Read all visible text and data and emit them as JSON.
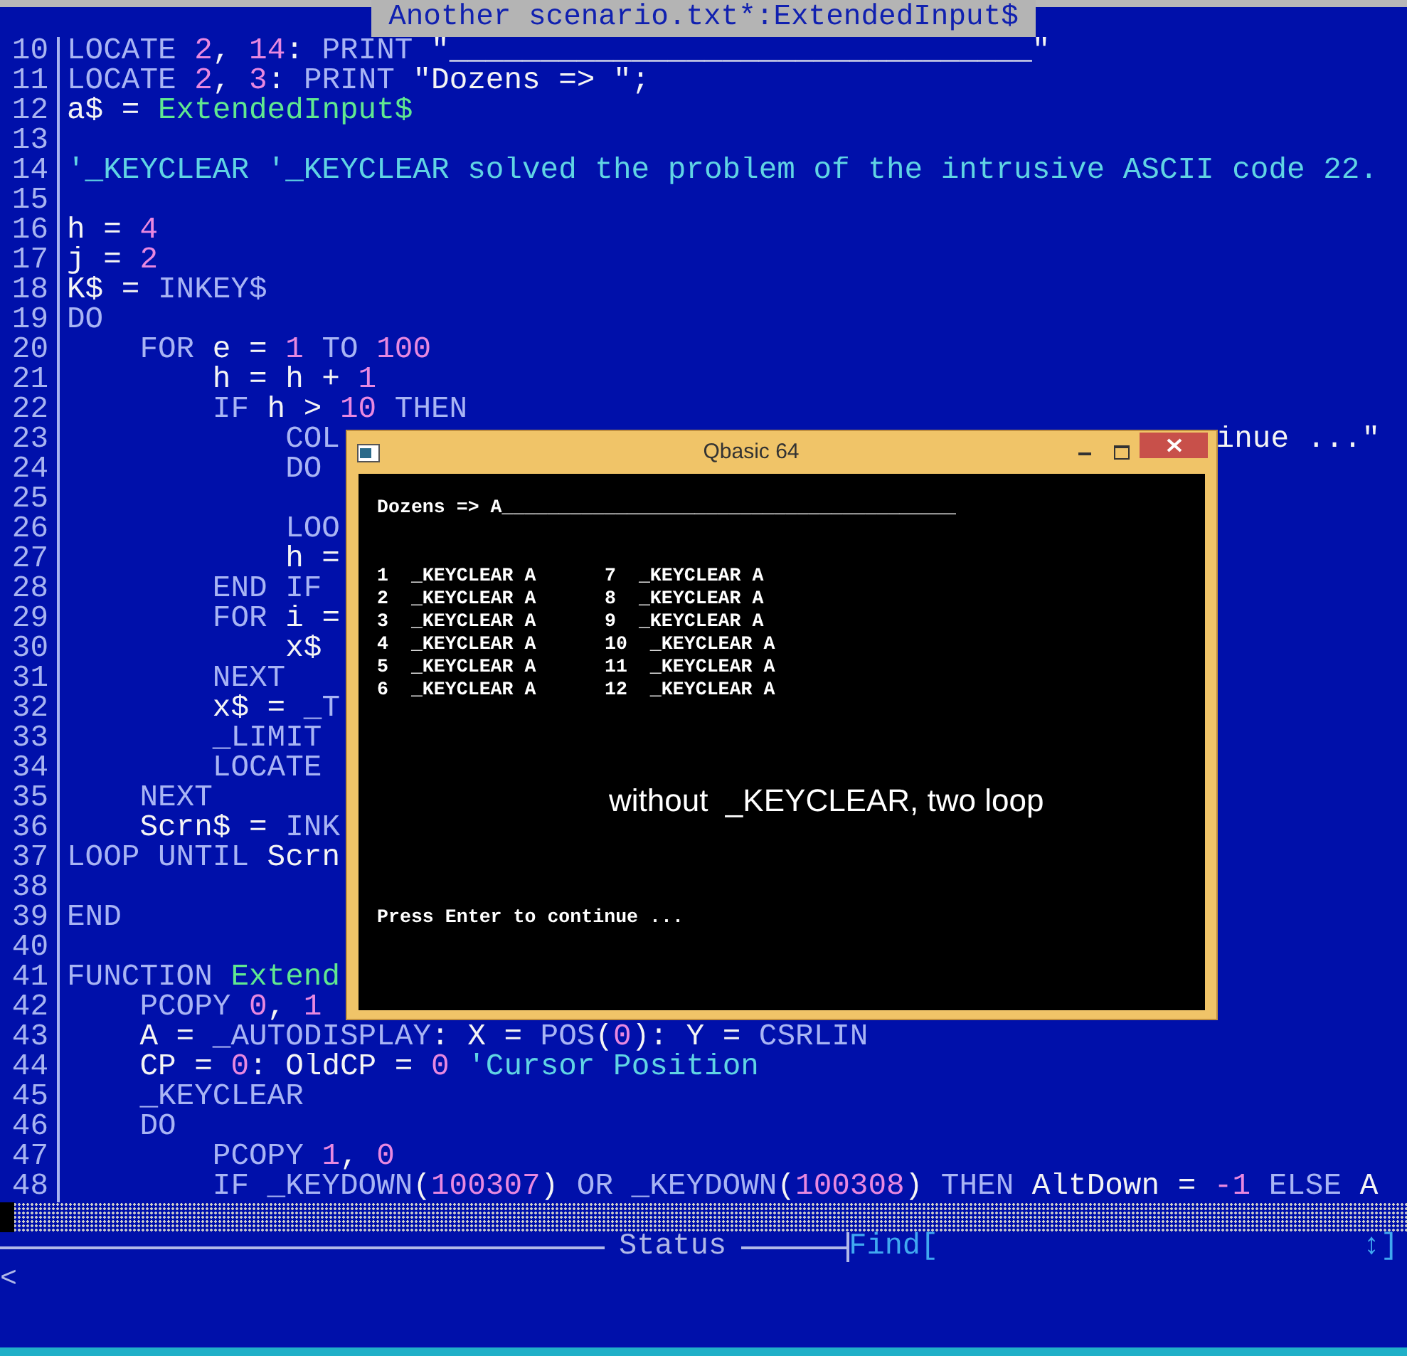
{
  "editor": {
    "title": "Another scenario.txt*:ExtendedInput$",
    "lines": [
      {
        "number": "10",
        "tokens": [
          {
            "kind": "kw",
            "text": "LOCATE "
          },
          {
            "kind": "num",
            "text": "2"
          },
          {
            "kind": "id",
            "text": ", "
          },
          {
            "kind": "num",
            "text": "14"
          },
          {
            "kind": "id",
            "text": ": "
          },
          {
            "kind": "kw",
            "text": "PRINT "
          },
          {
            "kind": "str",
            "text": "\"________________________________\""
          }
        ]
      },
      {
        "number": "11",
        "tokens": [
          {
            "kind": "kw",
            "text": "LOCATE "
          },
          {
            "kind": "num",
            "text": "2"
          },
          {
            "kind": "id",
            "text": ", "
          },
          {
            "kind": "num",
            "text": "3"
          },
          {
            "kind": "id",
            "text": ": "
          },
          {
            "kind": "kw",
            "text": "PRINT "
          },
          {
            "kind": "str",
            "text": "\"Dozens => \";"
          }
        ]
      },
      {
        "number": "12",
        "tokens": [
          {
            "kind": "id",
            "text": "a$ = "
          },
          {
            "kind": "fn",
            "text": "ExtendedInput$"
          }
        ]
      },
      {
        "number": "13"
      },
      {
        "number": "14",
        "tokens": [
          {
            "kind": "cmt",
            "text": "'_KEYCLEAR '_KEYCLEAR solved the problem of the intrusive ASCII code 22."
          }
        ]
      },
      {
        "number": "15"
      },
      {
        "number": "16",
        "tokens": [
          {
            "kind": "id",
            "text": "h = "
          },
          {
            "kind": "num",
            "text": "4"
          }
        ]
      },
      {
        "number": "17",
        "tokens": [
          {
            "kind": "id",
            "text": "j = "
          },
          {
            "kind": "num",
            "text": "2"
          }
        ]
      },
      {
        "number": "18",
        "tokens": [
          {
            "kind": "id",
            "text": "K$ = "
          },
          {
            "kind": "kw",
            "text": "INKEY$"
          }
        ]
      },
      {
        "number": "19",
        "tokens": [
          {
            "kind": "kw",
            "text": "DO"
          }
        ]
      },
      {
        "number": "20",
        "tokens": [
          {
            "kind": "kw",
            "text": "    FOR "
          },
          {
            "kind": "id",
            "text": "e = "
          },
          {
            "kind": "num",
            "text": "1"
          },
          {
            "kind": "kw",
            "text": " TO "
          },
          {
            "kind": "num",
            "text": "100"
          }
        ]
      },
      {
        "number": "21",
        "tokens": [
          {
            "kind": "id",
            "text": "        h = h + "
          },
          {
            "kind": "num",
            "text": "1"
          }
        ]
      },
      {
        "number": "22",
        "tokens": [
          {
            "kind": "kw",
            "text": "        IF "
          },
          {
            "kind": "id",
            "text": "h > "
          },
          {
            "kind": "num",
            "text": "10"
          },
          {
            "kind": "kw",
            "text": " THEN"
          }
        ]
      },
      {
        "number": "23",
        "tokens": [
          {
            "kind": "kw",
            "text": "            COL"
          }
        ],
        "tail": [
          {
            "kind": "str",
            "text": "inue ...\""
          }
        ]
      },
      {
        "number": "24",
        "tokens": [
          {
            "kind": "kw",
            "text": "            DO"
          }
        ]
      },
      {
        "number": "25"
      },
      {
        "number": "26",
        "tokens": [
          {
            "kind": "kw",
            "text": "            LOO"
          }
        ]
      },
      {
        "number": "27",
        "tokens": [
          {
            "kind": "id",
            "text": "            h ="
          }
        ]
      },
      {
        "number": "28",
        "tokens": [
          {
            "kind": "kw",
            "text": "        END IF"
          }
        ]
      },
      {
        "number": "29",
        "tokens": [
          {
            "kind": "kw",
            "text": "        FOR "
          },
          {
            "kind": "id",
            "text": "i ="
          }
        ]
      },
      {
        "number": "30",
        "tokens": [
          {
            "kind": "id",
            "text": "            x$"
          }
        ]
      },
      {
        "number": "31",
        "tokens": [
          {
            "kind": "kw",
            "text": "        NEXT"
          }
        ]
      },
      {
        "number": "32",
        "tokens": [
          {
            "kind": "id",
            "text": "        x$ = "
          },
          {
            "kind": "kw",
            "text": "_T"
          }
        ]
      },
      {
        "number": "33",
        "tokens": [
          {
            "kind": "kw",
            "text": "        _LIMIT"
          }
        ]
      },
      {
        "number": "34",
        "tokens": [
          {
            "kind": "kw",
            "text": "        LOCATE"
          }
        ]
      },
      {
        "number": "35",
        "tokens": [
          {
            "kind": "kw",
            "text": "    NEXT"
          }
        ]
      },
      {
        "number": "36",
        "tokens": [
          {
            "kind": "id",
            "text": "    Scrn$ = "
          },
          {
            "kind": "kw",
            "text": "INK"
          }
        ]
      },
      {
        "number": "37",
        "tokens": [
          {
            "kind": "kw",
            "text": "LOOP UNTIL "
          },
          {
            "kind": "id",
            "text": "Scrn"
          }
        ]
      },
      {
        "number": "38"
      },
      {
        "number": "39",
        "tokens": [
          {
            "kind": "kw",
            "text": "END"
          }
        ]
      },
      {
        "number": "40"
      },
      {
        "number": "41",
        "tokens": [
          {
            "kind": "kw",
            "text": "FUNCTION "
          },
          {
            "kind": "fn",
            "text": "Extend"
          }
        ]
      },
      {
        "number": "42",
        "tokens": [
          {
            "kind": "kw",
            "text": "    PCOPY "
          },
          {
            "kind": "num",
            "text": "0"
          },
          {
            "kind": "id",
            "text": ", "
          },
          {
            "kind": "num",
            "text": "1"
          }
        ]
      },
      {
        "number": "43",
        "tokens": [
          {
            "kind": "id",
            "text": "    A = "
          },
          {
            "kind": "kw",
            "text": "_AUTODISPLAY"
          },
          {
            "kind": "id",
            "text": ": X = "
          },
          {
            "kind": "kw",
            "text": "POS"
          },
          {
            "kind": "id",
            "text": "("
          },
          {
            "kind": "num",
            "text": "0"
          },
          {
            "kind": "id",
            "text": "): Y = "
          },
          {
            "kind": "kw",
            "text": "CSRLIN"
          }
        ]
      },
      {
        "number": "44",
        "tokens": [
          {
            "kind": "id",
            "text": "    CP = "
          },
          {
            "kind": "num",
            "text": "0"
          },
          {
            "kind": "id",
            "text": ": OldCP = "
          },
          {
            "kind": "num",
            "text": "0"
          },
          {
            "kind": "cmt",
            "text": " 'Cursor Position"
          }
        ]
      },
      {
        "number": "45",
        "tokens": [
          {
            "kind": "kw",
            "text": "    _KEYCLEAR"
          }
        ]
      },
      {
        "number": "46",
        "tokens": [
          {
            "kind": "kw",
            "text": "    DO"
          }
        ]
      },
      {
        "number": "47",
        "tokens": [
          {
            "kind": "kw",
            "text": "        PCOPY "
          },
          {
            "kind": "num",
            "text": "1"
          },
          {
            "kind": "id",
            "text": ", "
          },
          {
            "kind": "num",
            "text": "0"
          }
        ]
      },
      {
        "number": "48",
        "tokens": [
          {
            "kind": "kw",
            "text": "        IF _KEYDOWN"
          },
          {
            "kind": "id",
            "text": "("
          },
          {
            "kind": "num",
            "text": "100307"
          },
          {
            "kind": "id",
            "text": ") "
          },
          {
            "kind": "kw",
            "text": "OR _KEYDOWN"
          },
          {
            "kind": "id",
            "text": "("
          },
          {
            "kind": "num",
            "text": "100308"
          },
          {
            "kind": "id",
            "text": ") "
          },
          {
            "kind": "kw",
            "text": "THEN "
          },
          {
            "kind": "id",
            "text": "AltDown = "
          },
          {
            "kind": "num",
            "text": "-1"
          },
          {
            "kind": "kw",
            "text": " ELSE "
          },
          {
            "kind": "id",
            "text": "A"
          }
        ]
      }
    ]
  },
  "status_bar": {
    "label": "Status",
    "find_label": "Find[",
    "find_end": "↕]",
    "message": "<"
  },
  "console_window": {
    "title": "Qbasic 64",
    "prompt": "Dozens => A________________________________________",
    "columns": [
      [
        "1  _KEYCLEAR A",
        "2  _KEYCLEAR A",
        "3  _KEYCLEAR A",
        "4  _KEYCLEAR A",
        "5  _KEYCLEAR A",
        "6  _KEYCLEAR A"
      ],
      [
        "7  _KEYCLEAR A",
        "8  _KEYCLEAR A",
        "9  _KEYCLEAR A",
        "10  _KEYCLEAR A",
        "11  _KEYCLEAR A",
        "12  _KEYCLEAR A"
      ]
    ],
    "caption": "without  _KEYCLEAR, two loop",
    "footer": "Press Enter to continue ..."
  }
}
